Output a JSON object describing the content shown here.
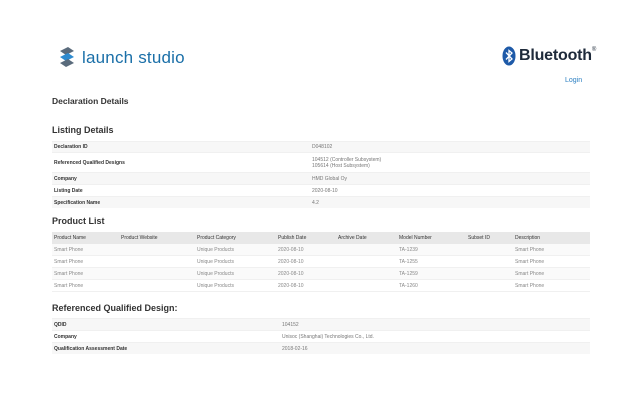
{
  "header": {
    "brand": "launch studio",
    "partner_brand": "Bluetooth",
    "partner_mark": "®",
    "login": "Login"
  },
  "page_title": "Declaration Details",
  "listing": {
    "title": "Listing Details",
    "rows": [
      {
        "label": "Declaration ID",
        "value": "D048102"
      },
      {
        "label": "Referenced Qualified Designs",
        "value": "104512 (Controller Subsystem)",
        "value2": "105614 (Host Subsystem)"
      },
      {
        "label": "Company",
        "value": "HMD Global Oy"
      },
      {
        "label": "Listing Date",
        "value": "2020-08-10"
      },
      {
        "label": "Specification Name",
        "value": "4.2"
      }
    ]
  },
  "product_list": {
    "title": "Product List",
    "columns": [
      "Product Name",
      "Product Website",
      "Product Category",
      "Publish Date",
      "Archive Date",
      "Model Number",
      "Subset ID",
      "Description"
    ],
    "rows": [
      [
        "Smart Phone",
        "",
        "Unique Products",
        "2020-08-10",
        "",
        "TA-1239",
        "",
        "Smart Phone"
      ],
      [
        "Smart Phone",
        "",
        "Unique Products",
        "2020-08-10",
        "",
        "TA-1255",
        "",
        "Smart Phone"
      ],
      [
        "Smart Phone",
        "",
        "Unique Products",
        "2020-08-10",
        "",
        "TA-1259",
        "",
        "Smart Phone"
      ],
      [
        "Smart Phone",
        "",
        "Unique Products",
        "2020-08-10",
        "",
        "TA-1260",
        "",
        "Smart Phone"
      ]
    ]
  },
  "rqd": {
    "title": "Referenced Qualified Design:",
    "rows": [
      {
        "label": "QDID",
        "value": "104152"
      },
      {
        "label": "Company",
        "value": "Unisoc (Shanghai) Technologies Co., Ltd."
      },
      {
        "label": "Qualification Assessment Date",
        "value": "2018-02-16"
      }
    ]
  },
  "colors": {
    "brand": "#1a6fa8",
    "link": "#2b7fc2",
    "header_row": "#e8e8e8"
  }
}
